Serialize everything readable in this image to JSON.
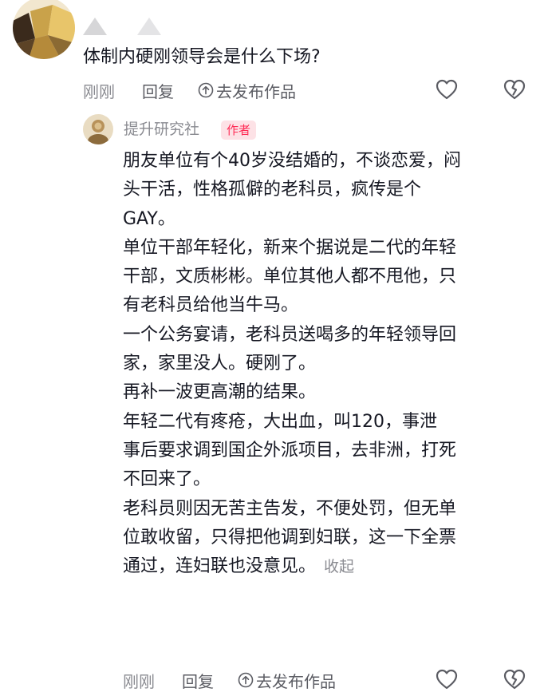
{
  "comment": {
    "avatar_icon": "cartoon-avatar",
    "text": "体制内硬刚领导会是什么下场?",
    "time": "刚刚",
    "reply_label": "回复",
    "publish_label": "去发布作品",
    "like_icon": "heart-outline-icon",
    "dislike_icon": "broken-heart-icon"
  },
  "reply": {
    "avatar_icon": "profile-avatar",
    "author": "提升研究社",
    "author_badge": "作者",
    "lines": [
      "朋友单位有个40岁没结婚的，不谈恋爱，闷",
      "头干活，性格孤僻的老科员，疯传是个",
      "GAY。",
      "单位干部年轻化，新来个据说是二代的年轻",
      "干部，文质彬彬。单位其他人都不甩他，只",
      "有老科员给他当牛马。",
      "一个公务宴请，老科员送喝多的年轻领导回",
      "家，家里没人。硬刚了。",
      "再补一波更高潮的结果。",
      "年轻二代有疼疮，大出血，叫120，事泄",
      "事后要求调到国企外派项目，去非洲，打死",
      "不回来了。",
      "老科员则因无苦主告发，不便处罚，但无单",
      "位敢收留，只得把他调到妇联，这一下全票",
      "通过，连妇联也没意见。"
    ],
    "collapse_label": "收起",
    "time": "刚刚",
    "reply_label": "回复",
    "publish_label": "去发布作品",
    "like_icon": "heart-outline-icon",
    "dislike_icon": "broken-heart-icon"
  },
  "colors": {
    "text_primary": "#161823",
    "text_secondary": "#8a8b91",
    "badge_text": "#fe2c55",
    "badge_bg": "#fde2e6"
  }
}
